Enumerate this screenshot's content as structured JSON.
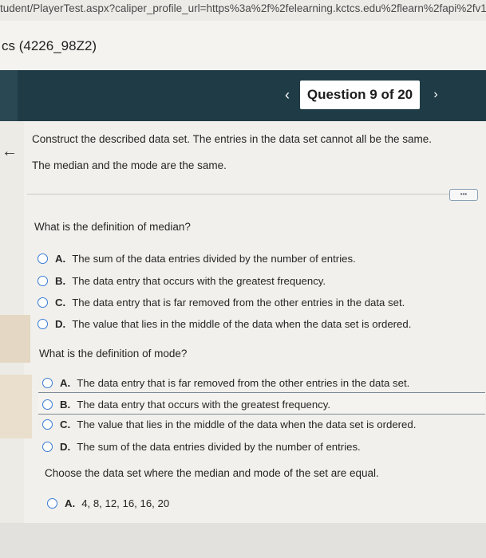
{
  "browser": {
    "url": "tudent/PlayerTest.aspx?caliper_profile_url=https%3a%2f%2felearning.kctcs.edu%2flearn%2fapi%2fv1%2"
  },
  "course": {
    "title": "cs (4226_98Z2)"
  },
  "header": {
    "prev_label": "‹",
    "question_label": "Question 9 of 20",
    "next_label": "›"
  },
  "problem": {
    "instruction": "Construct the described data set. The entries in the data set cannot all be the same.",
    "condition": "The median and the mode are the same."
  },
  "more_button": "•••",
  "part1": {
    "question": "What is the definition of median?",
    "options": [
      {
        "letter": "A.",
        "text": "The sum of the data entries divided by the number of entries."
      },
      {
        "letter": "B.",
        "text": "The data entry that occurs with the greatest frequency."
      },
      {
        "letter": "C.",
        "text": "The data entry that is far removed from the other entries in the data set."
      },
      {
        "letter": "D.",
        "text": "The value that lies in the middle of the data when the data set is ordered."
      }
    ]
  },
  "part2": {
    "question": "What is the definition of mode?",
    "options": [
      {
        "letter": "A.",
        "text": "The data entry that is far removed from the other entries in the data set."
      },
      {
        "letter": "B.",
        "text": "The data entry that occurs with the greatest frequency."
      },
      {
        "letter": "C.",
        "text": "The value that lies in the middle of the data when the data set is ordered."
      },
      {
        "letter": "D.",
        "text": "The sum of the data entries divided by the number of entries."
      }
    ]
  },
  "part3": {
    "question": "Choose the data set where the median and mode of the set are equal.",
    "options": [
      {
        "letter": "A.",
        "text": "4, 8, 12, 16, 16, 20"
      }
    ]
  }
}
